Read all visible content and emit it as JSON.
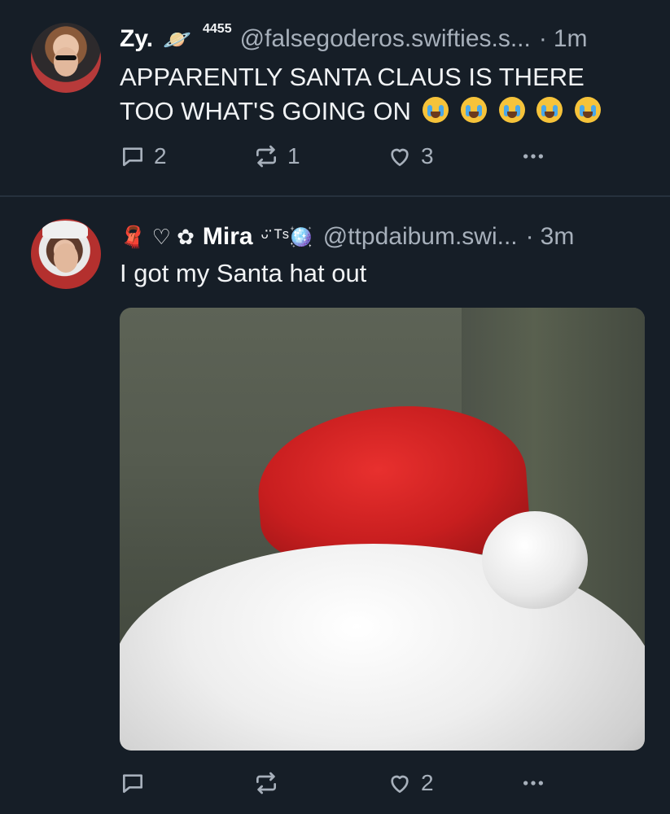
{
  "posts": [
    {
      "display_name": "Zy.",
      "name_emoji": "🪐",
      "name_suffix": "4455",
      "handle": "@falsegoderos.swifties.s...",
      "time": "1m",
      "text": "APPARENTLY SANTA CLAUS IS THERE TOO WHAT'S GOING ON",
      "text_emojis": [
        "crying-face",
        "crying-face",
        "crying-face",
        "crying-face",
        "crying-face"
      ],
      "replies": "2",
      "reposts": "1",
      "likes": "3"
    },
    {
      "name_prefix": "🧣 ♡ ✿",
      "display_name": "Mira",
      "name_suffix": "ᵕ̈ ᵀˢ🪩",
      "handle": "@ttpdaibum.swi...",
      "time": "3m",
      "text": "I got my Santa hat out",
      "replies": "",
      "reposts": "",
      "likes": "2"
    }
  ],
  "icons": {
    "reply": "speech-bubble-icon",
    "repost": "repost-arrows-icon",
    "like": "heart-outline-icon",
    "more": "ellipsis-icon"
  },
  "colors": {
    "background": "#161e27",
    "text": "#f1f3f5",
    "muted": "#a7b0bb",
    "divider": "#26313d"
  }
}
